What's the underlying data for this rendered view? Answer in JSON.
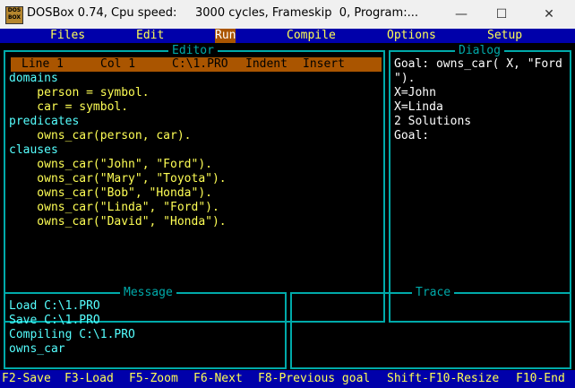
{
  "window": {
    "title": "DOSBox 0.74, Cpu speed:     3000 cycles, Frameskip  0, Program:...",
    "icon_text": "DOS BOX",
    "minimize": "—",
    "maximize": "☐",
    "close": "✕"
  },
  "menu": {
    "files": "Files",
    "edit": "Edit",
    "run": "Run",
    "compile": "Compile",
    "options": "Options",
    "setup": "Setup"
  },
  "editor": {
    "title": "Editor",
    "status": {
      "line": "Line 1",
      "col": "Col 1",
      "file": "C:\\1.PRO",
      "indent": "Indent",
      "insert": "Insert"
    },
    "lines": [
      "domains",
      "    person = symbol.",
      "    car = symbol.",
      "predicates",
      "    owns_car(person, car).",
      "clauses",
      "    owns_car(\"John\", \"Ford\").",
      "    owns_car(\"Mary\", \"Toyota\").",
      "    owns_car(\"Bob\", \"Honda\").",
      "    owns_car(\"Linda\", \"Ford\").",
      "    owns_car(\"David\", \"Honda\")."
    ]
  },
  "dialog": {
    "title": "Dialog",
    "lines": [
      "Goal: owns_car( X, \"Ford",
      "\").",
      "X=John",
      "X=Linda",
      "2 Solutions",
      "Goal:"
    ]
  },
  "message": {
    "title": "Message",
    "lines": [
      "Load C:\\1.PRO",
      "Save C:\\1.PRO",
      "Compiling C:\\1.PRO",
      "owns_car"
    ]
  },
  "trace": {
    "title": "Trace"
  },
  "keys": {
    "f2": "F2-Save",
    "f3": "F3-Load",
    "f5": "F5-Zoom",
    "f6": "F6-Next",
    "f8": "F8-Previous goal",
    "sf10": "Shift-F10-Resize",
    "f10": "F10-End"
  }
}
